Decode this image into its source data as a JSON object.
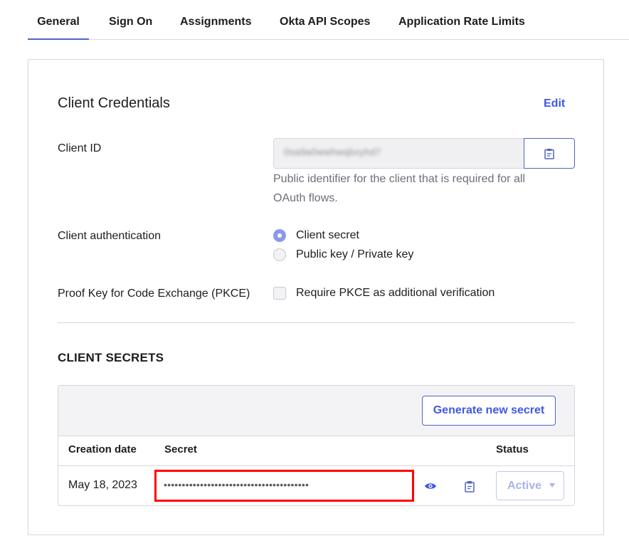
{
  "tabs": [
    {
      "label": "General",
      "active": true
    },
    {
      "label": "Sign On"
    },
    {
      "label": "Assignments"
    },
    {
      "label": "Okta API Scopes"
    },
    {
      "label": "Application Rate Limits"
    }
  ],
  "credentials": {
    "title": "Client Credentials",
    "edit_label": "Edit",
    "client_id_label": "Client ID",
    "client_id_value": "0oa9a0wwhwqbxyhd7",
    "client_id_help": "Public identifier for the client that is required for all OAuth flows.",
    "auth_label": "Client authentication",
    "auth_options": [
      {
        "label": "Client secret",
        "selected": true
      },
      {
        "label": "Public key / Private key",
        "selected": false
      }
    ],
    "pkce_label": "Proof Key for Code Exchange (PKCE)",
    "pkce_option": "Require PKCE as additional verification",
    "pkce_checked": false
  },
  "secrets": {
    "title": "CLIENT SECRETS",
    "generate_label": "Generate new secret",
    "columns": {
      "creation_date": "Creation date",
      "secret": "Secret",
      "status": "Status"
    },
    "rows": [
      {
        "creation_date": "May 18, 2023",
        "secret_masked": "••••••••••••••••••••••••••••••••••••••••",
        "status": "Active"
      }
    ]
  },
  "icons": {
    "copy": "clipboard-icon",
    "reveal": "eye-icon",
    "dropdown": "chevron-down-icon"
  },
  "colors": {
    "accent": "#4f63c9",
    "link": "#3f59e4",
    "highlight": "#ff0000",
    "disabled": "#a9b4e6"
  }
}
